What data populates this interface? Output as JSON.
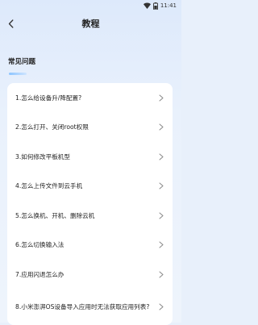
{
  "status_bar": {
    "time": "11:41"
  },
  "header": {
    "title": "教程"
  },
  "section": {
    "title": "常见问题"
  },
  "faq": {
    "items": [
      {
        "label": "1.怎么给设备升/降配置?"
      },
      {
        "label": "2.怎么打开、关闭root权限"
      },
      {
        "label": "3.如何修改平板机型"
      },
      {
        "label": "4.怎么上传文件到云手机"
      },
      {
        "label": "5.怎么换机、开机、删除云机"
      },
      {
        "label": "6.怎么切换输入法"
      },
      {
        "label": "7.应用闪退怎么办"
      },
      {
        "label": "8.小米澎湃OS设备导入应用时无法获取应用列表?"
      }
    ]
  },
  "colors": {
    "background": "#e8f0fb",
    "card": "#ffffff",
    "accent": "#8cc4ff",
    "text": "#222222",
    "chevron": "#888888"
  }
}
